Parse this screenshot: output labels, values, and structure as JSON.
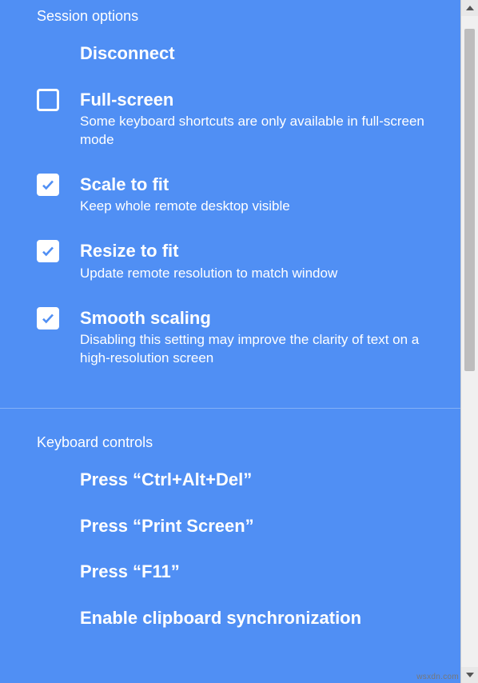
{
  "accent_color": "#508ff4",
  "sessionOptions": {
    "title": "Session options",
    "disconnect": {
      "label": "Disconnect"
    },
    "fullScreen": {
      "label": "Full-screen",
      "desc": "Some keyboard shortcuts are only available in full-screen mode",
      "checked": false
    },
    "scaleToFit": {
      "label": "Scale to fit",
      "desc": "Keep whole remote desktop visible",
      "checked": true
    },
    "resizeToFit": {
      "label": "Resize to fit",
      "desc": "Update remote resolution to match window",
      "checked": true
    },
    "smoothScaling": {
      "label": "Smooth scaling",
      "desc": "Disabling this setting may improve the clarity of text on a high-resolution screen",
      "checked": true
    }
  },
  "keyboardControls": {
    "title": "Keyboard controls",
    "ctrlAltDel": {
      "label": "Press “Ctrl+Alt+Del”"
    },
    "printScreen": {
      "label": "Press “Print Screen”"
    },
    "f11": {
      "label": "Press “F11”"
    },
    "clipboard": {
      "label": "Enable clipboard synchronization"
    }
  },
  "watermark": "wsxdn.com"
}
